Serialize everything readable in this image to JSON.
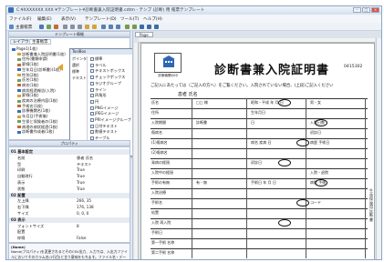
{
  "window": {
    "title": "C:¥XXXXXXX XXX ¥テンプレート¥診断書兼入院証明書.cdtm - テンプ (診断) 用 帳票テンプレート",
    "close": "×",
    "min": "–",
    "max": "□"
  },
  "menu": [
    "ファイル(F)",
    "編集(E)",
    "表示(V)",
    "テンプレート(D)",
    "ツール(T)",
    "ヘルプ(H)"
  ],
  "toolbar": {
    "template_label": "主書帳票"
  },
  "template_panel": {
    "header": "テンプレート情報",
    "tabs": [
      "レイアウト",
      "主書帳票"
    ],
    "tree": [
      "Page1(1枚)",
      "診断書兼入院証明書(1枚)",
      "住所(書類申請)",
      "罫線(1枚)",
      "生年月日(診断書)(1枚)",
      "性別(2枚)",
      "氏名(1枚)",
      "病名(1枚)",
      "病状経過報告(入院)",
      "罫線(1枚)",
      "疾病の治療内容(1枚)",
      "手術名(1枚)",
      "診療機関名(1枚)",
      "年月日(手術後)",
      "生保と保険者の(1枚)",
      "病理の病状経過(1枚)",
      "診断書作成者(1枚)"
    ]
  },
  "toolbox": {
    "title": "ToolBox",
    "left_items": [
      "ポインタ",
      "選択",
      "標準",
      "テキスト"
    ],
    "items": [
      "標準",
      "ラベル",
      "テキストボックス",
      "チェックボックス",
      "ラジオグループ",
      "ライン",
      "四角形",
      "円",
      "PNGイメージ",
      "JPEGイメージ",
      "PRIイメージグループ",
      "日付テキスト",
      "数値テキスト",
      "テーブル",
      "ボタン",
      "固有"
    ]
  },
  "properties": {
    "header": "プロパティ",
    "rows": [
      {
        "k": "01 基本設定",
        "v": "",
        "sec": true
      },
      {
        "k": "名前",
        "v": "患者 氏名"
      },
      {
        "k": "型",
        "v": "テキスト"
      },
      {
        "k": "印刷",
        "v": "True"
      },
      {
        "k": "自動改行",
        "v": "True"
      },
      {
        "k": "表示",
        "v": "True"
      },
      {
        "k": "状態",
        "v": "True"
      },
      {
        "k": "02 配置",
        "v": "",
        "sec": true
      },
      {
        "k": "左上隅",
        "v": "266, 35"
      },
      {
        "k": "右下隅",
        "v": "176, 138"
      },
      {
        "k": "サイズ",
        "v": "0, 0, 0"
      },
      {
        "k": "03 表示",
        "v": "",
        "sec": true
      },
      {
        "k": "フォントサイズ",
        "v": "8"
      },
      {
        "k": "配置",
        "v": ""
      },
      {
        "k": "枠線",
        "v": "False"
      }
    ],
    "desc_title": "(Name)",
    "desc_text": "Name(プロパティ)を変更されるとそのCSV出力、入力では、入出力ファイルにおいてそのカラム名(1行目)と言う意味をもちます。ファイル名・データ名前と関連しているなどによって異なります。"
  },
  "doc": {
    "tab": "Page",
    "seal_text": "診療機関の印",
    "title": "診断書兼入院証明書",
    "number": "0415302",
    "note": "ご記入にあたっては（ご記入の方へ）をご覧ください。入院されていない場合、(上段)ご記入ください",
    "patient_name": "患者 氏名",
    "vertical_label": "生命保険用診断書",
    "rows": [
      {
        "a": "氏名",
        "b": "□□ 様",
        "c": "昭和・平成  年  月  日",
        "d": "男・女"
      },
      {
        "a": "住所",
        "b": "",
        "c": "生年月日",
        "d": ""
      },
      {
        "a": "入院期間",
        "b": "診断書",
        "c": "日",
        "d": "入院日数"
      },
      {
        "a": "傷病名",
        "b": "",
        "c": "",
        "d": "初診日"
      },
      {
        "a": "(1)傷病名",
        "b": "",
        "c": "病名 疾病 日",
        "d": "病歴 手術日"
      },
      {
        "a": "(2)傷病名",
        "b": "",
        "c": "",
        "d": ""
      },
      {
        "a": "発病の経過",
        "b": "",
        "c": "初診日",
        "d": ""
      },
      {
        "a": "入院中の経過",
        "b": "",
        "c": "",
        "d": "入院・退院"
      },
      {
        "a": "手術の有無",
        "b": "有・無",
        "c": "手術日 年 月 日",
        "d": "病院 手術"
      },
      {
        "a": "入院治療",
        "b": "",
        "c": "",
        "d": ""
      },
      {
        "a": "手術名",
        "b": "",
        "c": "",
        "d": "コード"
      },
      {
        "a": "処置",
        "b": "",
        "c": "",
        "d": ""
      },
      {
        "a": "入院 再入院",
        "b": "",
        "c": "",
        "d": ""
      },
      {
        "a": "手術日",
        "b": "",
        "c": "",
        "d": ""
      },
      {
        "a": "第一手術 名称",
        "b": "",
        "c": "",
        "d": ""
      },
      {
        "a": "第二手術 名称",
        "b": "",
        "c": "",
        "d": ""
      }
    ]
  }
}
